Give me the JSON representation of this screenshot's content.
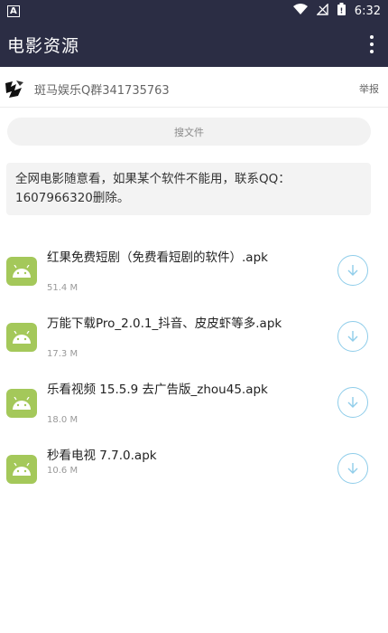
{
  "status_bar": {
    "carrier_icon": "A",
    "time": "6:32",
    "icons": [
      "wifi-icon",
      "signal-off-icon",
      "battery-icon"
    ]
  },
  "app_bar": {
    "title": "电影资源",
    "menu_icon": "more-vert-icon"
  },
  "uploader": {
    "name": "斑马娱乐Q群341735763",
    "report_label": "举报"
  },
  "search": {
    "placeholder": "搜文件"
  },
  "notice": {
    "text": "全网电影随意看，如果某个软件不能用，联系QQ：1607966320删除。"
  },
  "files": [
    {
      "name": "红果免费短剧（免费看短剧的软件）.apk",
      "size": "51.4 M"
    },
    {
      "name": "万能下载Pro_2.0.1_抖音、皮皮虾等多.apk",
      "size": "17.3 M"
    },
    {
      "name": "乐看视频 15.5.9 去广告版_zhou45.apk",
      "size": "18.0 M"
    },
    {
      "name": "秒看电视 7.7.0.apk",
      "size": "10.6 M"
    }
  ],
  "colors": {
    "app_bar": "#2b2d44",
    "file_icon": "#a4c85a",
    "download_ring": "#8fcdea"
  }
}
